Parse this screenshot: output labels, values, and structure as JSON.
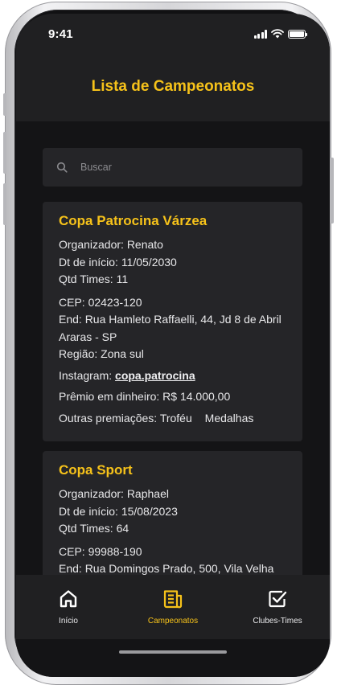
{
  "status_bar": {
    "time": "9:41"
  },
  "header": {
    "title": "Lista de Campeonatos"
  },
  "search": {
    "placeholder": "Buscar"
  },
  "championships": [
    {
      "name": "Copa Patrocina Várzea",
      "organizer": "Organizador: Renato",
      "start_date": "Dt de início: 11/05/2030",
      "teams": "Qtd Times: 11",
      "cep": "CEP: 02423-120",
      "address": "End: Rua Hamleto Raffaelli, 44, Jd 8 de Abril",
      "city": "Araras - SP",
      "region": "Região: Zona sul",
      "instagram_label": "Instagram: ",
      "instagram_handle": "copa.patrocina",
      "cash_prize": "Prêmio em dinheiro: R$ 14.000,00",
      "other_prizes_label": "Outras premiações:",
      "other_prizes": [
        "Troféu",
        "Medalhas"
      ]
    },
    {
      "name": "Copa Sport",
      "organizer": "Organizador: Raphael",
      "start_date": "Dt de início: 15/08/2023",
      "teams": "Qtd Times: 64",
      "cep": "CEP: 99988-190",
      "address": "End: Rua Domingos Prado, 500, Vila Velha"
    }
  ],
  "tabs": [
    {
      "label": "Início",
      "icon": "home-icon",
      "active": false
    },
    {
      "label": "Campeonatos",
      "icon": "newspaper-icon",
      "active": true
    },
    {
      "label": "Clubes-Times",
      "icon": "checkbox-icon",
      "active": false
    }
  ],
  "colors": {
    "accent": "#f6c21a",
    "background": "#141416",
    "surface": "#252528",
    "bar": "#202022"
  }
}
